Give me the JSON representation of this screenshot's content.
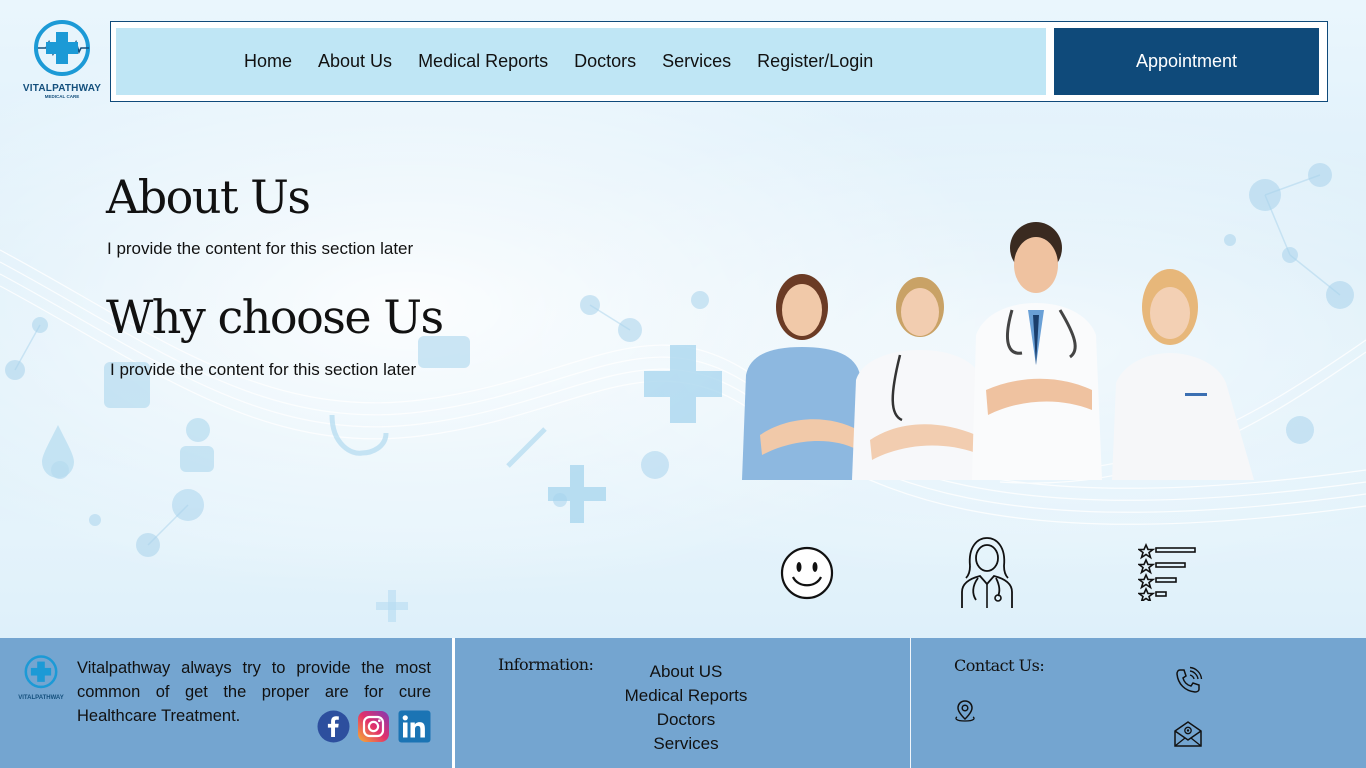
{
  "brand": {
    "name": "VITALPATHWAY",
    "tagline": "MEDICAL CARE"
  },
  "nav": {
    "items": [
      "Home",
      "About Us",
      "Medical Reports",
      "Doctors",
      "Services",
      "Register/Login"
    ],
    "cta": "Appointment"
  },
  "about": {
    "title": "About Us",
    "text": "I provide the content for this section later"
  },
  "why": {
    "title": "Why choose Us",
    "text": "I provide the content for this section later"
  },
  "features": {
    "icons": [
      "smiley-face-icon",
      "doctor-icon",
      "rating-list-icon"
    ]
  },
  "footer": {
    "description": "Vitalpathway always try to provide the most common of get the proper are for cure Healthcare Treatment.",
    "social": [
      "facebook-icon",
      "instagram-icon",
      "linkedin-icon"
    ],
    "info_heading": "Information:",
    "info_links": [
      "About US",
      "Medical Reports",
      "Doctors",
      "Services"
    ],
    "contact_heading": "Contact Us:",
    "contact_icons": [
      "location-pin-icon",
      "phone-icon",
      "email-icon"
    ]
  },
  "colors": {
    "primary": "#0f4a7a",
    "nav_bg": "#bfe6f5",
    "footer_bg": "#74a5d0",
    "brand_cross": "#1c9ad6"
  }
}
